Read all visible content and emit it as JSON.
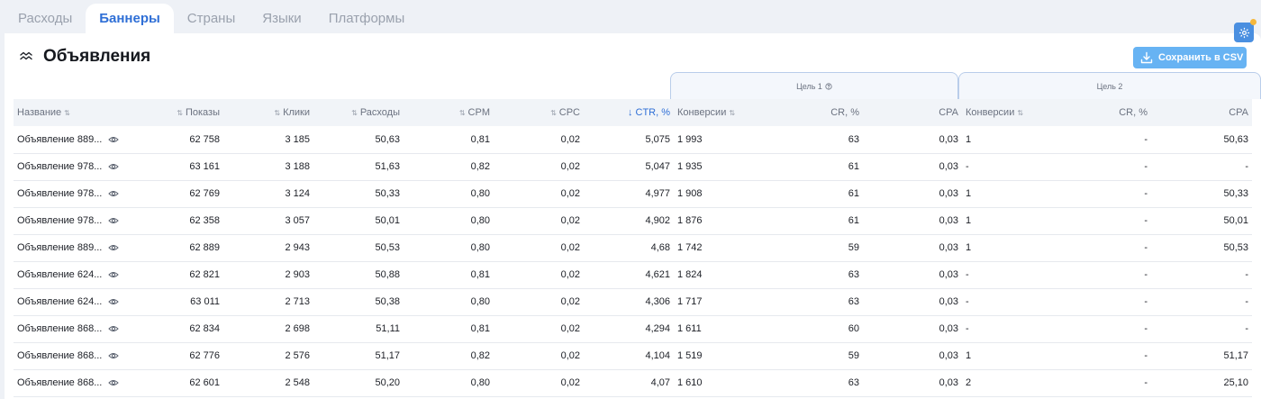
{
  "tabs": [
    "Расходы",
    "Баннеры",
    "Страны",
    "Языки",
    "Платформы"
  ],
  "active_tab": 1,
  "section": {
    "title": "Объявления"
  },
  "toolbar": {
    "csv_label": "Сохранить в CSV"
  },
  "goals": {
    "goal1": "Цель 1",
    "goal2": "Цель 2"
  },
  "columns": [
    {
      "label": "Название",
      "align": "l",
      "sort": "after"
    },
    {
      "label": "Показы",
      "align": "r",
      "sort": "before"
    },
    {
      "label": "Клики",
      "align": "r",
      "sort": "before"
    },
    {
      "label": "Расходы",
      "align": "r",
      "sort": "before"
    },
    {
      "label": "CPM",
      "align": "r",
      "sort": "before"
    },
    {
      "label": "CPC",
      "align": "r",
      "sort": "before"
    },
    {
      "label": "CTR, %",
      "align": "r",
      "sort": "active"
    },
    {
      "label": "Конверсии",
      "align": "l",
      "sort": "after"
    },
    {
      "label": "CR, %",
      "align": "r",
      "sort": "none"
    },
    {
      "label": "CPA",
      "align": "r",
      "sort": "none"
    },
    {
      "label": "Конверсии",
      "align": "l",
      "sort": "after"
    },
    {
      "label": "CR, %",
      "align": "r",
      "sort": "none"
    },
    {
      "label": "CPA",
      "align": "r",
      "sort": "none"
    }
  ],
  "rows": [
    [
      "Объявление 889...",
      "62 758",
      "3 185",
      "50,63",
      "0,81",
      "0,02",
      "5,075",
      "1 993",
      "63",
      "0,03",
      "1",
      "-",
      "50,63"
    ],
    [
      "Объявление 978...",
      "63 161",
      "3 188",
      "51,63",
      "0,82",
      "0,02",
      "5,047",
      "1 935",
      "61",
      "0,03",
      "-",
      "-",
      "-"
    ],
    [
      "Объявление 978...",
      "62 769",
      "3 124",
      "50,33",
      "0,80",
      "0,02",
      "4,977",
      "1 908",
      "61",
      "0,03",
      "1",
      "-",
      "50,33"
    ],
    [
      "Объявление 978...",
      "62 358",
      "3 057",
      "50,01",
      "0,80",
      "0,02",
      "4,902",
      "1 876",
      "61",
      "0,03",
      "1",
      "-",
      "50,01"
    ],
    [
      "Объявление 889...",
      "62 889",
      "2 943",
      "50,53",
      "0,80",
      "0,02",
      "4,68",
      "1 742",
      "59",
      "0,03",
      "1",
      "-",
      "50,53"
    ],
    [
      "Объявление 624...",
      "62 821",
      "2 903",
      "50,88",
      "0,81",
      "0,02",
      "4,621",
      "1 824",
      "63",
      "0,03",
      "-",
      "-",
      "-"
    ],
    [
      "Объявление 624...",
      "63 011",
      "2 713",
      "50,38",
      "0,80",
      "0,02",
      "4,306",
      "1 717",
      "63",
      "0,03",
      "-",
      "-",
      "-"
    ],
    [
      "Объявление 868...",
      "62 834",
      "2 698",
      "51,11",
      "0,81",
      "0,02",
      "4,294",
      "1 611",
      "60",
      "0,03",
      "-",
      "-",
      "-"
    ],
    [
      "Объявление 868...",
      "62 776",
      "2 576",
      "51,17",
      "0,82",
      "0,02",
      "4,104",
      "1 519",
      "59",
      "0,03",
      "1",
      "-",
      "51,17"
    ],
    [
      "Объявление 868...",
      "62 601",
      "2 548",
      "50,20",
      "0,80",
      "0,02",
      "4,07",
      "1 610",
      "63",
      "0,03",
      "2",
      "-",
      "25,10"
    ]
  ],
  "colors": {
    "accent": "#2f6fd6",
    "csv_button": "#67b3f3",
    "notification": "#f5b73b"
  }
}
